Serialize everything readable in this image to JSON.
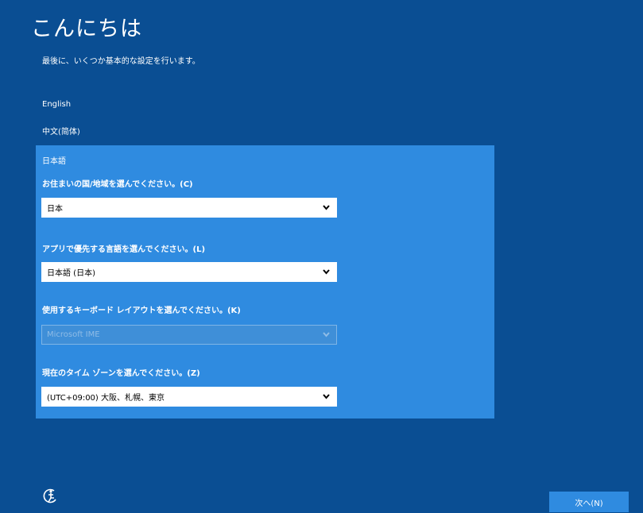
{
  "header": {
    "title": "こんにちは",
    "subtitle": "最後に、いくつか基本的な設定を行います。"
  },
  "languages": [
    {
      "label": "English"
    },
    {
      "label": "中文(简体)"
    },
    {
      "label": "日本語",
      "selected": true
    }
  ],
  "form": {
    "country": {
      "label": "お住まいの国/地域を選んでください。(C)",
      "value": "日本"
    },
    "app_language": {
      "label": "アプリで優先する言語を選んでください。(L)",
      "value": "日本語 (日本)"
    },
    "keyboard": {
      "label": "使用するキーボード レイアウトを選んでください。(K)",
      "value": "Microsoft IME",
      "disabled": true
    },
    "timezone": {
      "label": "現在のタイム ゾーンを選んでください。(Z)",
      "value": "(UTC+09:00) 大阪、札幌、東京"
    }
  },
  "footer": {
    "next_label": "次へ(N)",
    "ease_of_access_icon": "ease-of-access-icon"
  },
  "colors": {
    "background": "#0a4e93",
    "panel": "#2f8be0",
    "button": "#2f8be0",
    "text": "#ffffff"
  }
}
